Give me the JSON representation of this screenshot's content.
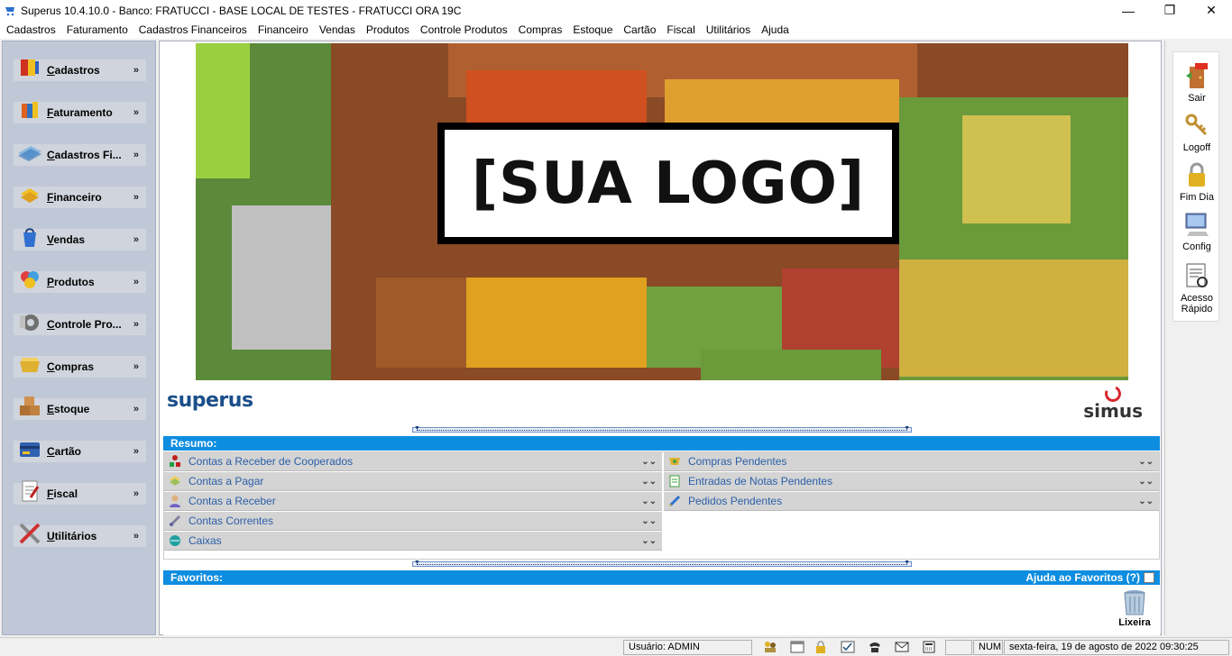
{
  "window": {
    "title": "Superus 10.4.10.0 - Banco: FRATUCCI - BASE LOCAL DE TESTES - FRATUCCI ORA 19C",
    "minimize": "—",
    "maximize": "❐",
    "close": "✕"
  },
  "menu": [
    "Cadastros",
    "Faturamento",
    "Cadastros Financeiros",
    "Financeiro",
    "Vendas",
    "Produtos",
    "Controle Produtos",
    "Compras",
    "Estoque",
    "Cartão",
    "Fiscal",
    "Utilitários",
    "Ajuda"
  ],
  "sidebar": {
    "items": [
      {
        "label": "Cadastros",
        "icon": "cadastros-icon",
        "color": "#d03020"
      },
      {
        "label": "Faturamento",
        "icon": "faturamento-icon",
        "color": "#e06020"
      },
      {
        "label": "Cadastros Fi...",
        "icon": "cadastros-financeiros-icon",
        "color": "#4080c0"
      },
      {
        "label": "Financeiro",
        "icon": "financeiro-icon",
        "color": "#e0a020"
      },
      {
        "label": "Vendas",
        "icon": "vendas-icon",
        "color": "#3070d0"
      },
      {
        "label": "Produtos",
        "icon": "produtos-icon",
        "color": "#e04040"
      },
      {
        "label": "Controle Pro...",
        "icon": "controle-produtos-icon",
        "color": "#606060"
      },
      {
        "label": "Compras",
        "icon": "compras-icon",
        "color": "#e0b030"
      },
      {
        "label": "Estoque",
        "icon": "estoque-icon",
        "color": "#b07030"
      },
      {
        "label": "Cartão",
        "icon": "cartao-icon",
        "color": "#3060b0"
      },
      {
        "label": "Fiscal",
        "icon": "fiscal-icon",
        "color": "#c02020"
      },
      {
        "label": "Utilitários",
        "icon": "utilitarios-icon",
        "color": "#d03030"
      }
    ]
  },
  "banner": {
    "logo_text": "[SUA LOGO]"
  },
  "brands": {
    "left": "superus",
    "right": "simus"
  },
  "resumo": {
    "title": "Resumo:",
    "left_items": [
      {
        "label": "Contas a Receber de Cooperados",
        "icon": "cooperados-icon"
      },
      {
        "label": "Contas a Pagar",
        "icon": "contas-pagar-icon"
      },
      {
        "label": "Contas a Receber",
        "icon": "contas-receber-icon"
      },
      {
        "label": "Contas Correntes",
        "icon": "contas-correntes-icon"
      },
      {
        "label": "Caixas",
        "icon": "caixas-icon"
      }
    ],
    "right_items": [
      {
        "label": "Compras Pendentes",
        "icon": "compras-pendentes-icon"
      },
      {
        "label": "Entradas de Notas Pendentes",
        "icon": "entradas-notas-icon"
      },
      {
        "label": "Pedidos Pendentes",
        "icon": "pedidos-pendentes-icon"
      }
    ]
  },
  "favoritos": {
    "title": "Favoritos:",
    "help": "Ajuda ao Favoritos (?)",
    "trash_label": "Lixeira"
  },
  "rightbar": {
    "items": [
      {
        "label": "Sair",
        "icon": "exit-door-icon"
      },
      {
        "label": "Logoff",
        "icon": "keys-icon"
      },
      {
        "label": "Fim Dia",
        "icon": "padlock-icon"
      },
      {
        "label": "Config",
        "icon": "computer-icon"
      },
      {
        "label": "Acesso Rápido",
        "icon": "quick-access-icon"
      }
    ]
  },
  "status": {
    "user": "Usuário: ADMIN",
    "num": "NUM",
    "datetime": "sexta-feira, 19 de agosto de 2022 09:30:25"
  }
}
